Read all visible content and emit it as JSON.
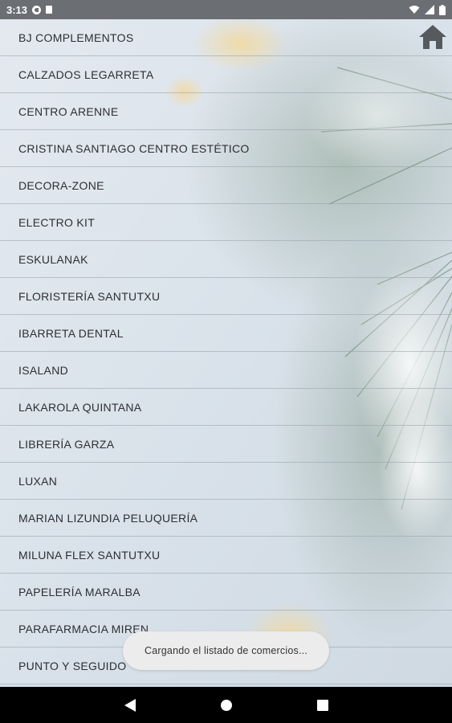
{
  "status_bar": {
    "time": "3:13",
    "icons": [
      "sync-icon",
      "sd-card-icon",
      "wifi-icon",
      "signal-icon",
      "battery-icon"
    ]
  },
  "header": {
    "home_icon": "home-icon"
  },
  "stores": [
    "BJ COMPLEMENTOS",
    "CALZADOS LEGARRETA",
    "CENTRO ARENNE",
    "CRISTINA SANTIAGO CENTRO ESTÉTICO",
    "DECORA-ZONE",
    "ELECTRO KIT",
    "ESKULANAK",
    "FLORISTERÍA SANTUTXU",
    "IBARRETA DENTAL",
    "ISALAND",
    "LAKAROLA QUINTANA",
    "LIBRERÍA GARZA",
    "LUXAN",
    "MARIAN LIZUNDIA PELUQUERÍA",
    "MILUNA FLEX SANTUTXU",
    "PAPELERÍA MARALBA",
    "PARAFARMACIA MIREN",
    "PUNTO Y SEGUIDO"
  ],
  "toast": {
    "message": "Cargando el listado de comercios..."
  },
  "nav_bar": {
    "back_icon": "back-triangle-icon",
    "home_icon": "home-circle-icon",
    "recents_icon": "recents-square-icon"
  },
  "colors": {
    "status_bar": "#6b6e72",
    "text": "#2c2f33",
    "toast_bg": "#ececec",
    "nav_bar": "#000000"
  }
}
